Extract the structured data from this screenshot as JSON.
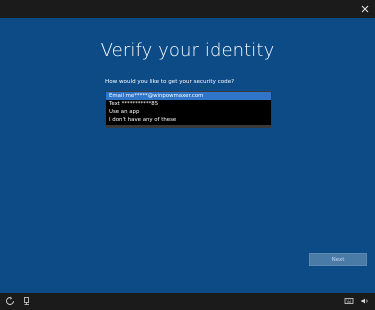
{
  "screen": {
    "title": "Verify your identity",
    "question": "How would you like to get your security code?",
    "options": [
      "Email me*****@winpowmaxer.com",
      "Text ***********85",
      "Use an app",
      "I don't have any of these"
    ],
    "selected_index": 0,
    "next_label": "Next"
  },
  "colors": {
    "panel": "#0d4b87",
    "selection": "#2f75c9",
    "bar": "#1b1b1b"
  },
  "icons": {
    "close": "close-icon",
    "ease_of_access": "ease-of-access-icon",
    "network": "network-icon",
    "keyboard": "keyboard-icon",
    "volume": "volume-icon"
  }
}
